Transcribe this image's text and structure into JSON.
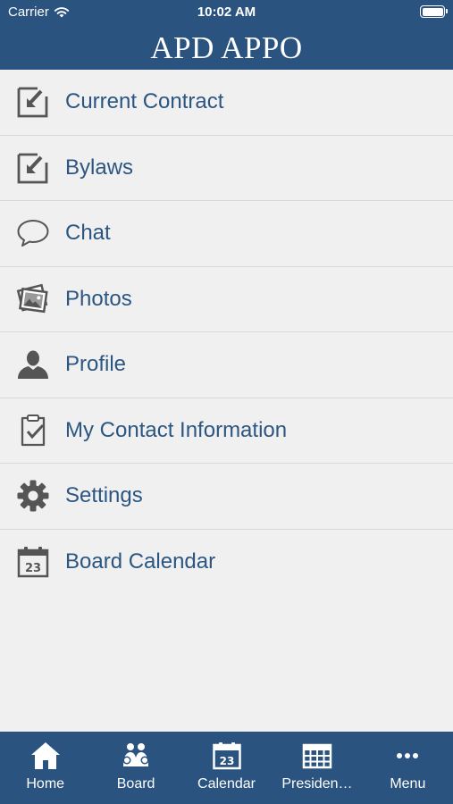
{
  "status_bar": {
    "carrier": "Carrier",
    "time": "10:02 AM"
  },
  "app": {
    "title": "APD APPO"
  },
  "menu_items": [
    {
      "label": "Current Contract",
      "icon": "document-arrow-icon"
    },
    {
      "label": "Bylaws",
      "icon": "document-arrow-icon"
    },
    {
      "label": "Chat",
      "icon": "speech-bubble-icon"
    },
    {
      "label": "Photos",
      "icon": "photos-icon"
    },
    {
      "label": "Profile",
      "icon": "person-icon"
    },
    {
      "label": "My Contact Information",
      "icon": "clipboard-check-icon"
    },
    {
      "label": "Settings",
      "icon": "gear-icon"
    },
    {
      "label": "Board Calendar",
      "icon": "calendar-icon"
    }
  ],
  "calendar_icon_day": "23",
  "tab_bar": [
    {
      "label": "Home",
      "icon": "home-icon"
    },
    {
      "label": "Board",
      "icon": "board-people-icon"
    },
    {
      "label": "Calendar",
      "icon": "calendar-icon"
    },
    {
      "label": "Presiden…",
      "icon": "table-icon"
    },
    {
      "label": "Menu",
      "icon": "more-dots-icon"
    }
  ],
  "colors": {
    "primary": "#2a5380",
    "text": "#2c5682",
    "background": "#f0f0f0",
    "icon": "#555555"
  }
}
